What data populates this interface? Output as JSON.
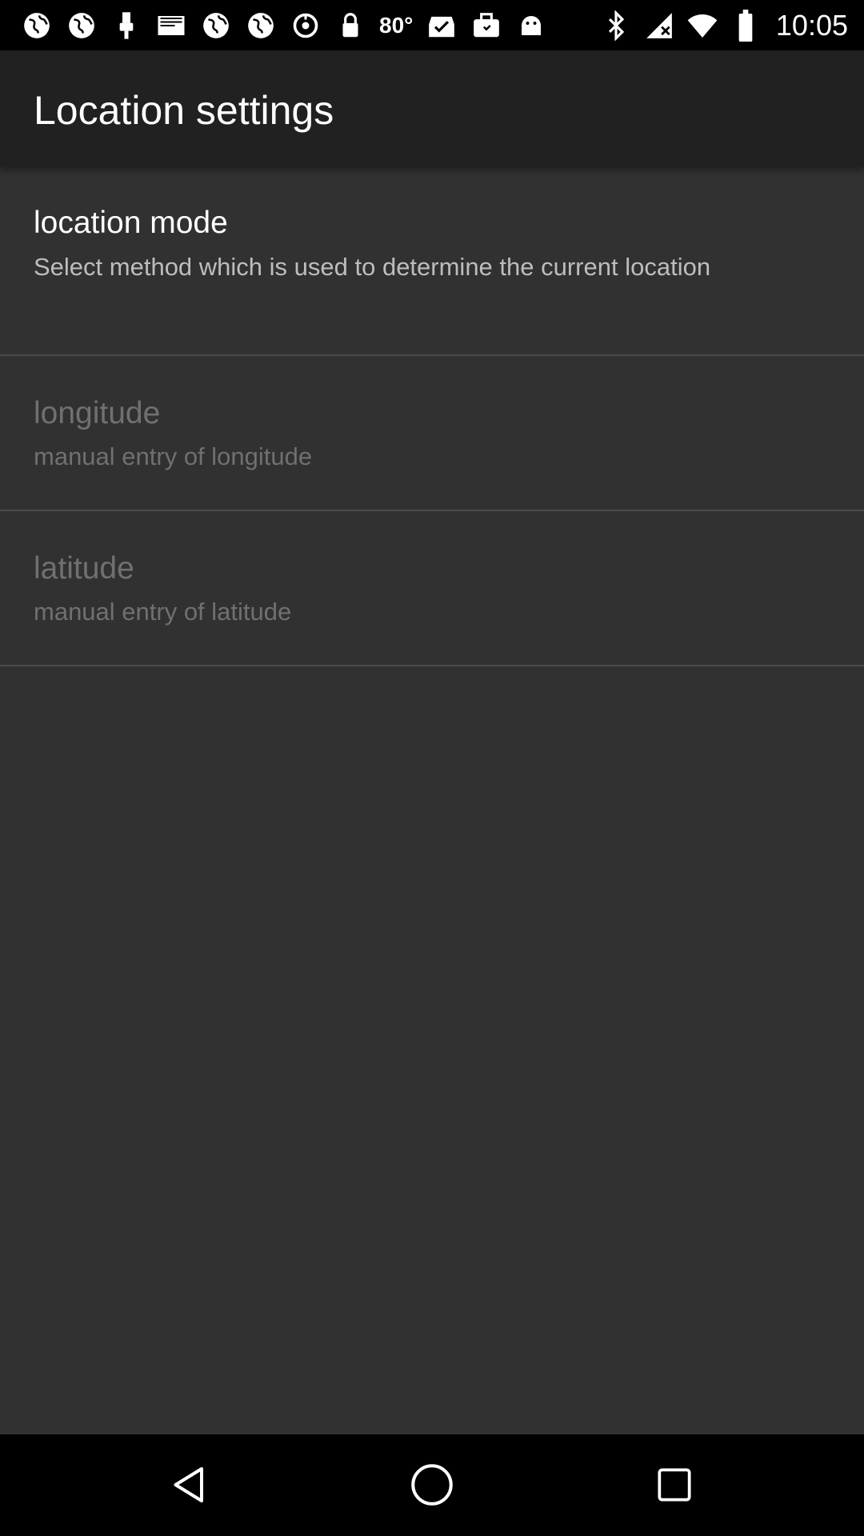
{
  "status_bar": {
    "time": "10:05",
    "temperature": "80°",
    "left_icons": [
      "globe-icon",
      "globe-icon",
      "usb-icon",
      "mail-icon",
      "globe-icon",
      "globe-icon",
      "sync-icon",
      "lock-icon",
      "weather-temp",
      "task-check-icon",
      "briefcase-icon",
      "android-icon"
    ],
    "right_icons": [
      "bluetooth-icon",
      "no-signal-icon",
      "wifi-icon",
      "battery-icon"
    ]
  },
  "header": {
    "title": "Location settings",
    "background": "#212121"
  },
  "preferences": [
    {
      "title": "location mode",
      "summary": "Select method which is used to determine the current location",
      "enabled": true
    },
    {
      "title": "longitude",
      "summary": "manual entry of longitude",
      "enabled": false
    },
    {
      "title": "latitude",
      "summary": "manual entry of latitude",
      "enabled": false
    }
  ],
  "nav_bar": {
    "buttons": [
      "back-icon",
      "home-icon",
      "recents-icon"
    ]
  },
  "colors": {
    "background": "#313131",
    "divider": "#4a4a4a",
    "text_primary": "#ffffff",
    "text_secondary": "#bdbdbd",
    "text_disabled": "#707070"
  }
}
